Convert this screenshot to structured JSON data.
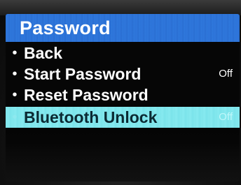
{
  "header": {
    "title": "Password"
  },
  "menu": {
    "items": [
      {
        "label": "Back",
        "value": ""
      },
      {
        "label": "Start Password",
        "value": "Off"
      },
      {
        "label": "Reset Password",
        "value": ""
      },
      {
        "label": "Bluetooth Unlock",
        "value": "Off",
        "selected": true
      }
    ],
    "bullet": "•"
  },
  "colors": {
    "title_bar": "#2c73d8",
    "selection": "#7fe6ec",
    "screen_bg": "#050505",
    "text": "#ffffff"
  }
}
